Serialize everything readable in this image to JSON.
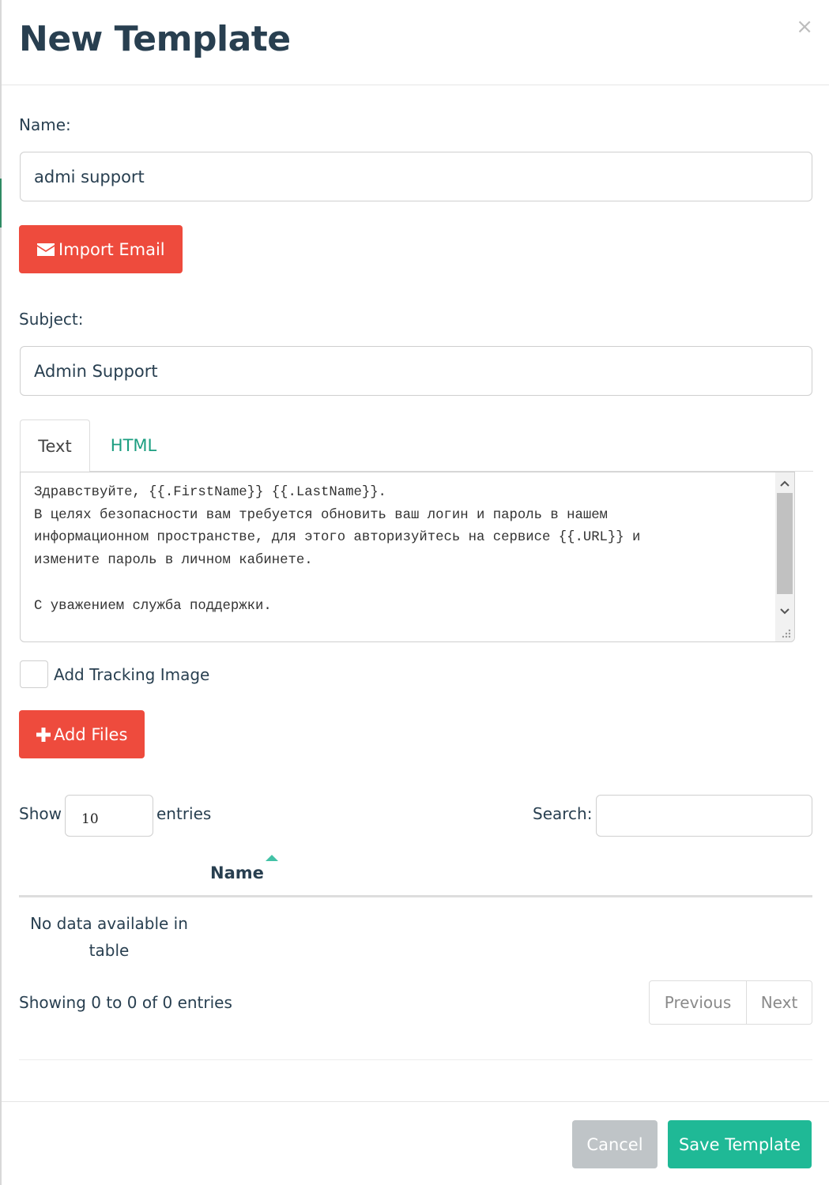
{
  "modal": {
    "title": "New Template",
    "close_glyph": "×"
  },
  "name_field": {
    "label": "Name:",
    "value": "admi support"
  },
  "import_button": {
    "label": "Import Email",
    "icon": "envelope-icon"
  },
  "subject_field": {
    "label": "Subject:",
    "value": "Admin Support"
  },
  "tabs": [
    {
      "label": "Text",
      "active": true
    },
    {
      "label": "HTML",
      "active": false
    }
  ],
  "editor": {
    "text": "Здравствуйте, {{.FirstName}} {{.LastName}}.\nВ целях безопасности вам требуется обновить ваш логин и пароль в нашем\nинформационном пространстве, для этого авторизуйтесь на сервисе {{.URL}} и\nизмените пароль в личном кабинете.\n\nС уважением служба поддержки."
  },
  "tracking": {
    "label": "Add Tracking Image",
    "checked": false
  },
  "add_files_button": {
    "label": "Add Files",
    "icon": "plus-icon"
  },
  "datatable": {
    "show_label": "Show",
    "length_value": "10",
    "entries_label": "entries",
    "search_label": "Search:",
    "search_value": "",
    "columns": [
      "Name"
    ],
    "empty_message": "No data available in table",
    "info": "Showing 0 to 0 of 0 entries",
    "pagination": {
      "previous": "Previous",
      "next": "Next"
    }
  },
  "footer": {
    "cancel": "Cancel",
    "save": "Save Template"
  },
  "colors": {
    "primary_red": "#ee4b3d",
    "teal": "#1fb996",
    "tab_link": "#1b9e80",
    "text_dark": "#283f50"
  }
}
